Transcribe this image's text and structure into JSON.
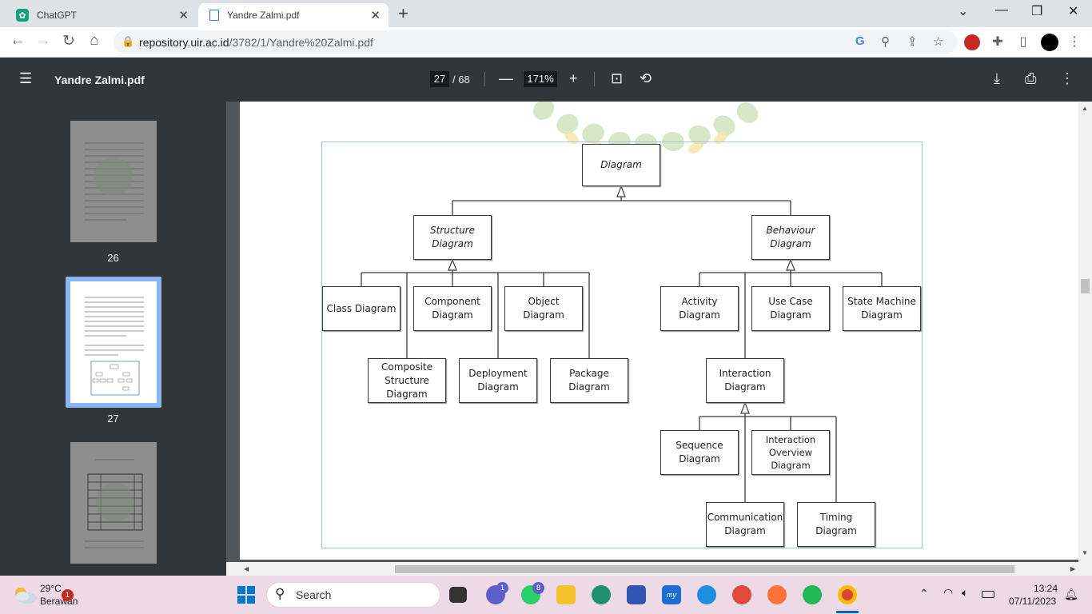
{
  "browser": {
    "tabs": [
      {
        "title": "ChatGPT",
        "active": false
      },
      {
        "title": "Yandre Zalmi.pdf",
        "active": true
      }
    ],
    "url_host": "repository.uir.ac.id",
    "url_path": "/3782/1/Yandre%20Zalmi.pdf"
  },
  "pdf": {
    "title": "Yandre Zalmi.pdf",
    "current_page": "27",
    "total_pages": "/ 68",
    "zoom": "171%"
  },
  "sidebar": {
    "thumbnails": [
      {
        "label": "26",
        "selected": false
      },
      {
        "label": "27",
        "selected": true
      },
      {
        "label": "",
        "selected": false
      }
    ]
  },
  "diagram": {
    "root": "Diagram",
    "structure": "Structure\nDiagram",
    "behaviour": "Behaviour\nDiagram",
    "class": "Class Diagram",
    "component": "Component\nDiagram",
    "object": "Object\nDiagram",
    "composite": "Composite\nStructure\nDiagram",
    "deployment": "Deployment\nDiagram",
    "package": "Package\nDiagram",
    "activity": "Activity\nDiagram",
    "usecase": "Use Case\nDiagram",
    "statemachine": "State Machine\nDiagram",
    "interaction": "Interaction\nDiagram",
    "sequence": "Sequence\nDiagram",
    "overview": "Interaction\nOverview\nDiagram",
    "communication": "Communication\nDiagram",
    "timing": "Timing\nDiagram"
  },
  "taskbar": {
    "weather_temp": "29°C",
    "weather_desc": "Berawan",
    "weather_badge": "1",
    "search_label": "Search",
    "teams_badge": "1",
    "whatsapp_badge": "8",
    "time": "13:24",
    "date": "07/11/2023"
  },
  "icons": [
    "chatgpt-favicon",
    "pdf-favicon",
    "back-arrow-icon",
    "forward-arrow-icon",
    "reload-icon",
    "home-icon",
    "lock-icon",
    "google-icon",
    "zoom-icon",
    "share-icon",
    "star-icon",
    "extension-icon",
    "sidepanel-icon",
    "hamburger-icon",
    "minus-icon",
    "plus-icon",
    "fit-page-icon",
    "rotate-icon",
    "download-icon",
    "print-icon",
    "more-vertical-icon",
    "windows-start-icon",
    "search-icon",
    "wifi-icon",
    "speaker-icon",
    "battery-icon",
    "bell-icon"
  ]
}
